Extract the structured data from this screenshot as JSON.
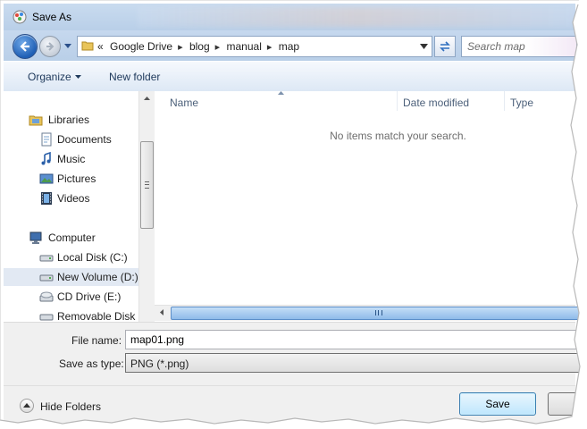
{
  "window": {
    "title": "Save As"
  },
  "address": {
    "overflow": "«",
    "crumbs": [
      "Google Drive",
      "blog",
      "manual",
      "map"
    ]
  },
  "search": {
    "placeholder": "Search map"
  },
  "toolbar": {
    "organize_label": "Organize",
    "new_folder_label": "New folder"
  },
  "nav": {
    "items": [
      {
        "label": "Libraries",
        "icon": "libraries-icon"
      },
      {
        "label": "Documents",
        "icon": "documents-icon"
      },
      {
        "label": "Music",
        "icon": "music-icon"
      },
      {
        "label": "Pictures",
        "icon": "pictures-icon"
      },
      {
        "label": "Videos",
        "icon": "videos-icon"
      },
      {
        "label": "Computer",
        "icon": "computer-icon"
      },
      {
        "label": "Local Disk (C:)",
        "icon": "drive-icon"
      },
      {
        "label": "New Volume (D:)",
        "icon": "drive-icon",
        "selected": true
      },
      {
        "label": "CD Drive (E:)",
        "icon": "cd-drive-icon"
      },
      {
        "label": "Removable Disk (",
        "icon": "removable-drive-icon"
      }
    ]
  },
  "files": {
    "columns": [
      "Name",
      "Date modified",
      "Type"
    ],
    "empty_message": "No items match your search."
  },
  "form": {
    "file_name_label": "File name:",
    "file_name_value": "map01.png",
    "save_type_label": "Save as type:",
    "save_type_value": "PNG (*.png)"
  },
  "footer": {
    "hide_folders_label": "Hide Folders",
    "save_label": "Save"
  },
  "colors": {
    "accent": "#1f5fb5",
    "chrome": "#c6d8ee",
    "selected": "#e2e9f3"
  }
}
